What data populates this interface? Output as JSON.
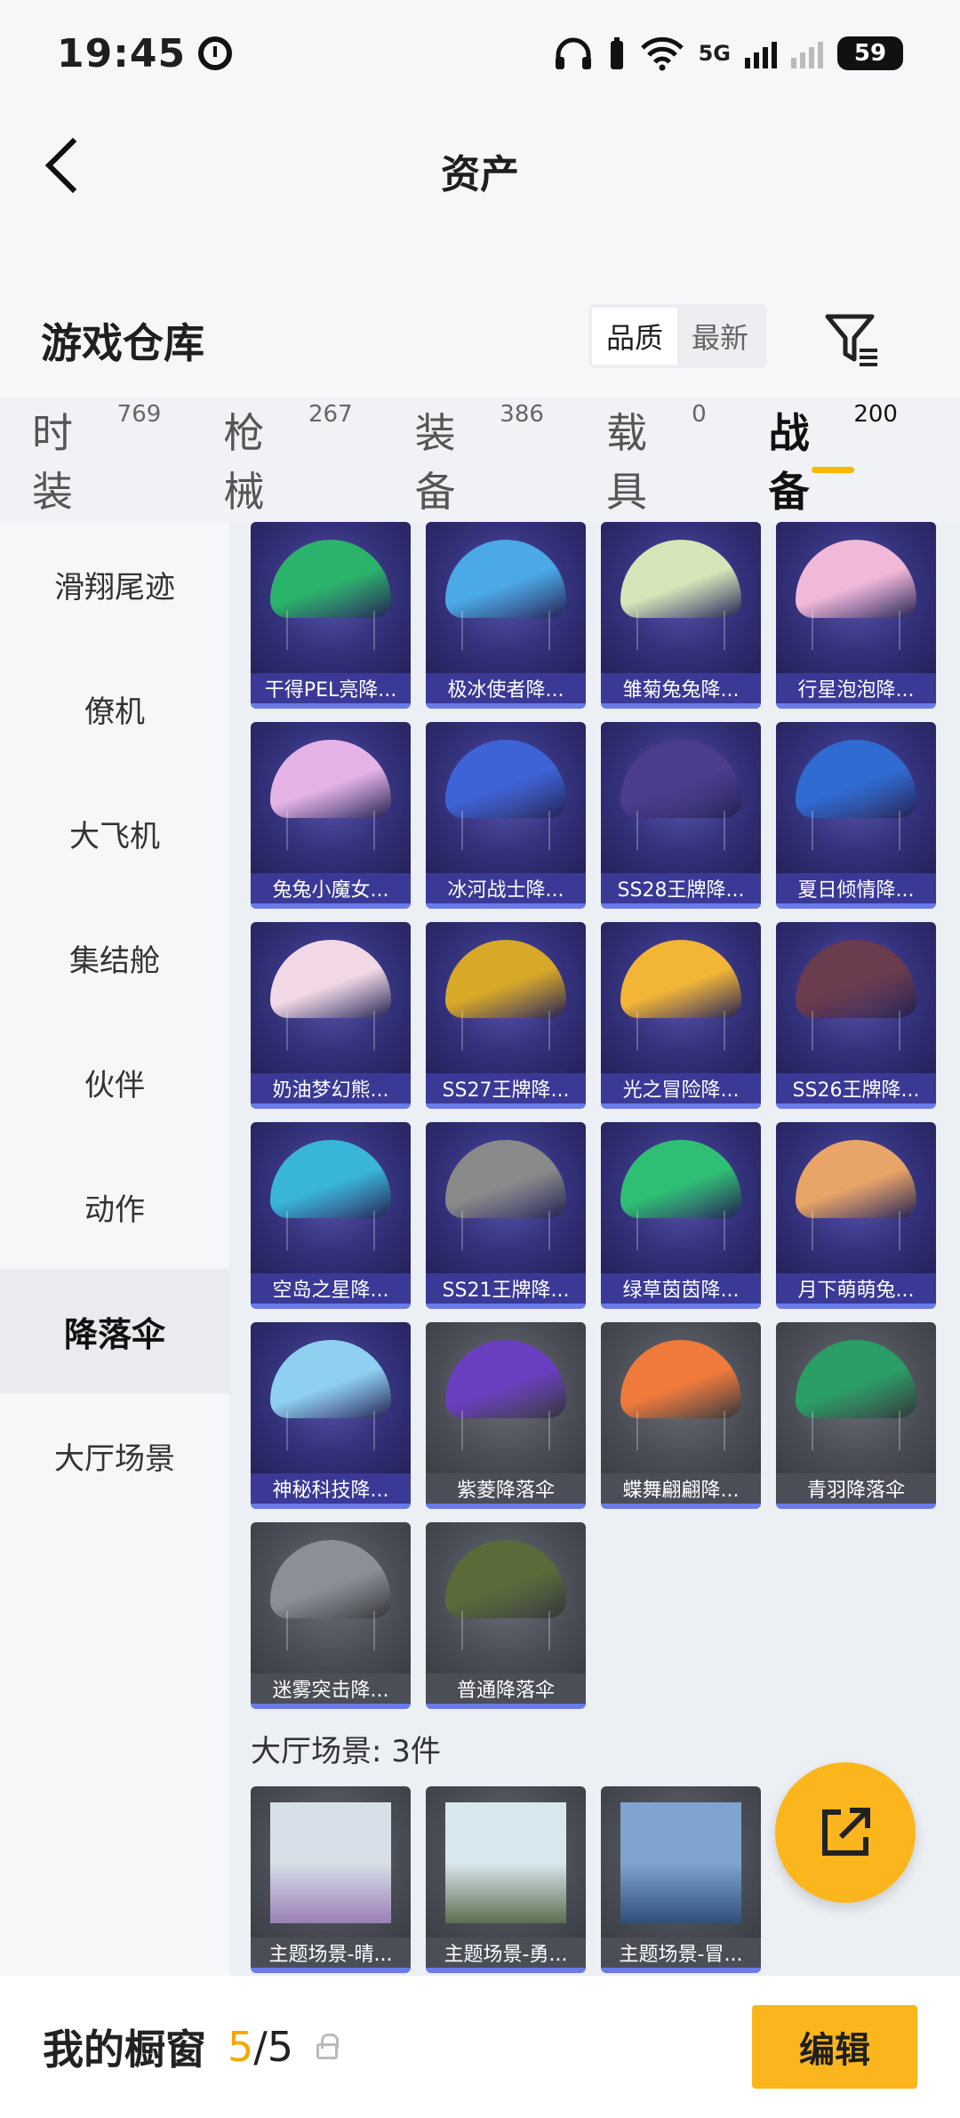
{
  "status_bar": {
    "time": "19:45",
    "network": "5G",
    "battery": "59",
    "icons": [
      "alarm-icon",
      "headphones-icon",
      "wifi-icon",
      "signal-icon",
      "battery-icon"
    ]
  },
  "header": {
    "title": "资产",
    "back_icon": "chevron-left-icon"
  },
  "warehouse": {
    "title": "游戏仓库",
    "sort_options": [
      "品质",
      "最新"
    ],
    "active_sort": "品质",
    "filter_icon": "filter-icon"
  },
  "tabs": [
    {
      "label": "时装",
      "count": "769"
    },
    {
      "label": "枪械",
      "count": "267"
    },
    {
      "label": "装备",
      "count": "386"
    },
    {
      "label": "载具",
      "count": "0"
    },
    {
      "label": "战备",
      "count": "200",
      "active": true
    }
  ],
  "sidebar": {
    "items": [
      "滑翔尾迹",
      "僚机",
      "大飞机",
      "集结舱",
      "伙伴",
      "动作",
      "降落伞",
      "大厅场景"
    ],
    "active": "降落伞"
  },
  "parachutes": [
    {
      "name": "干得PEL亮降...",
      "color": "#2bb36b",
      "style": "purple"
    },
    {
      "name": "极冰使者降...",
      "color": "#4aa9e6",
      "style": "purple"
    },
    {
      "name": "雏菊兔兔降...",
      "color": "#d5e6b8",
      "style": "purple"
    },
    {
      "name": "行星泡泡降...",
      "color": "#f2b8d8",
      "style": "purple"
    },
    {
      "name": "兔兔小魔女...",
      "color": "#e6b3e6",
      "style": "purple"
    },
    {
      "name": "冰河战士降...",
      "color": "#3e63d6",
      "style": "purple"
    },
    {
      "name": "SS28王牌降...",
      "color": "#4b3c8e",
      "style": "purple"
    },
    {
      "name": "夏日倾情降...",
      "color": "#2f6bd1",
      "style": "purple"
    },
    {
      "name": "奶油梦幻熊...",
      "color": "#f1d8e4",
      "style": "purple"
    },
    {
      "name": "SS27王牌降...",
      "color": "#d8a828",
      "style": "purple"
    },
    {
      "name": "光之冒险降...",
      "color": "#f3b536",
      "style": "purple"
    },
    {
      "name": "SS26王牌降...",
      "color": "#6b3b4e",
      "style": "purple"
    },
    {
      "name": "空岛之星降...",
      "color": "#39b5d9",
      "style": "purple"
    },
    {
      "name": "SS21王牌降...",
      "color": "#8a8a8a",
      "style": "purple"
    },
    {
      "name": "绿草茵茵降...",
      "color": "#2fbf74",
      "style": "purple"
    },
    {
      "name": "月下萌萌兔...",
      "color": "#e9a468",
      "style": "purple"
    },
    {
      "name": "神秘科技降...",
      "color": "#8fd0f0",
      "style": "purple"
    },
    {
      "name": "紫菱降落伞",
      "color": "#6a3fbf",
      "style": "gray"
    },
    {
      "name": "蝶舞翩翩降...",
      "color": "#f07a3c",
      "style": "gray"
    },
    {
      "name": "青羽降落伞",
      "color": "#2a9e66",
      "style": "gray"
    },
    {
      "name": "迷雾突击降...",
      "color": "#8c8f95",
      "style": "gray"
    },
    {
      "name": "普通降落伞",
      "color": "#5a6b3a",
      "style": "gray"
    }
  ],
  "lobby_scenes": {
    "title": "大厅场景: 3件",
    "items": [
      {
        "name": "主题场景-晴...",
        "sky": "#d7e0e8",
        "ground": "#9b7fb6"
      },
      {
        "name": "主题场景-勇...",
        "sky": "#d9e7ee",
        "ground": "#5c6e4f"
      },
      {
        "name": "主题场景-冒...",
        "sky": "#7fa4cf",
        "ground": "#2f4f7a"
      }
    ]
  },
  "share_button": {
    "icon": "share-external-icon"
  },
  "bottom": {
    "title": "我的橱窗",
    "current": "5",
    "separator": "/",
    "total": "5",
    "edit_label": "编辑"
  }
}
